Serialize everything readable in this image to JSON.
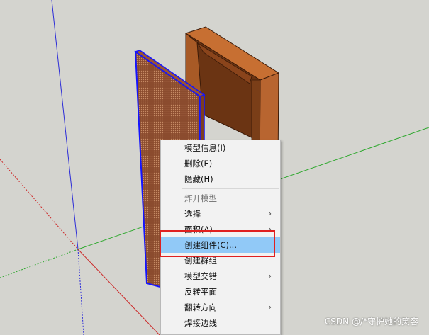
{
  "context_menu": {
    "items": [
      {
        "label": "模型信息(I)"
      },
      {
        "label": "删除(E)"
      },
      {
        "label": "隐藏(H)"
      },
      {
        "label": "炸开模型"
      },
      {
        "label": "选择",
        "arrow": "›"
      },
      {
        "label": "面积(A)",
        "arrow": "›"
      },
      {
        "label": "创建组件(C)..."
      },
      {
        "label": "创建群组"
      },
      {
        "label": "模型交错",
        "arrow": "›"
      },
      {
        "label": "反转平面"
      },
      {
        "label": "翻转方向",
        "arrow": "›"
      },
      {
        "label": "焊接边线"
      }
    ],
    "disabled_item": "炸开模型",
    "highlighted_item": "创建组件(C)..."
  },
  "watermark": "CSDN @/*守护她的笑容",
  "colors": {
    "background": "#d4d4cf",
    "axis_blue": "#2c2cd8",
    "axis_red": "#cc2a2a",
    "axis_green": "#2da82d",
    "door_brown": "#8a4a2a",
    "frame_wood": "#b8652e",
    "selection_blue": "#1414ff",
    "menu_highlight": "#91c9f7",
    "annotation_red": "#e02020"
  },
  "icons": {
    "submenu": "chevron-right-icon"
  }
}
